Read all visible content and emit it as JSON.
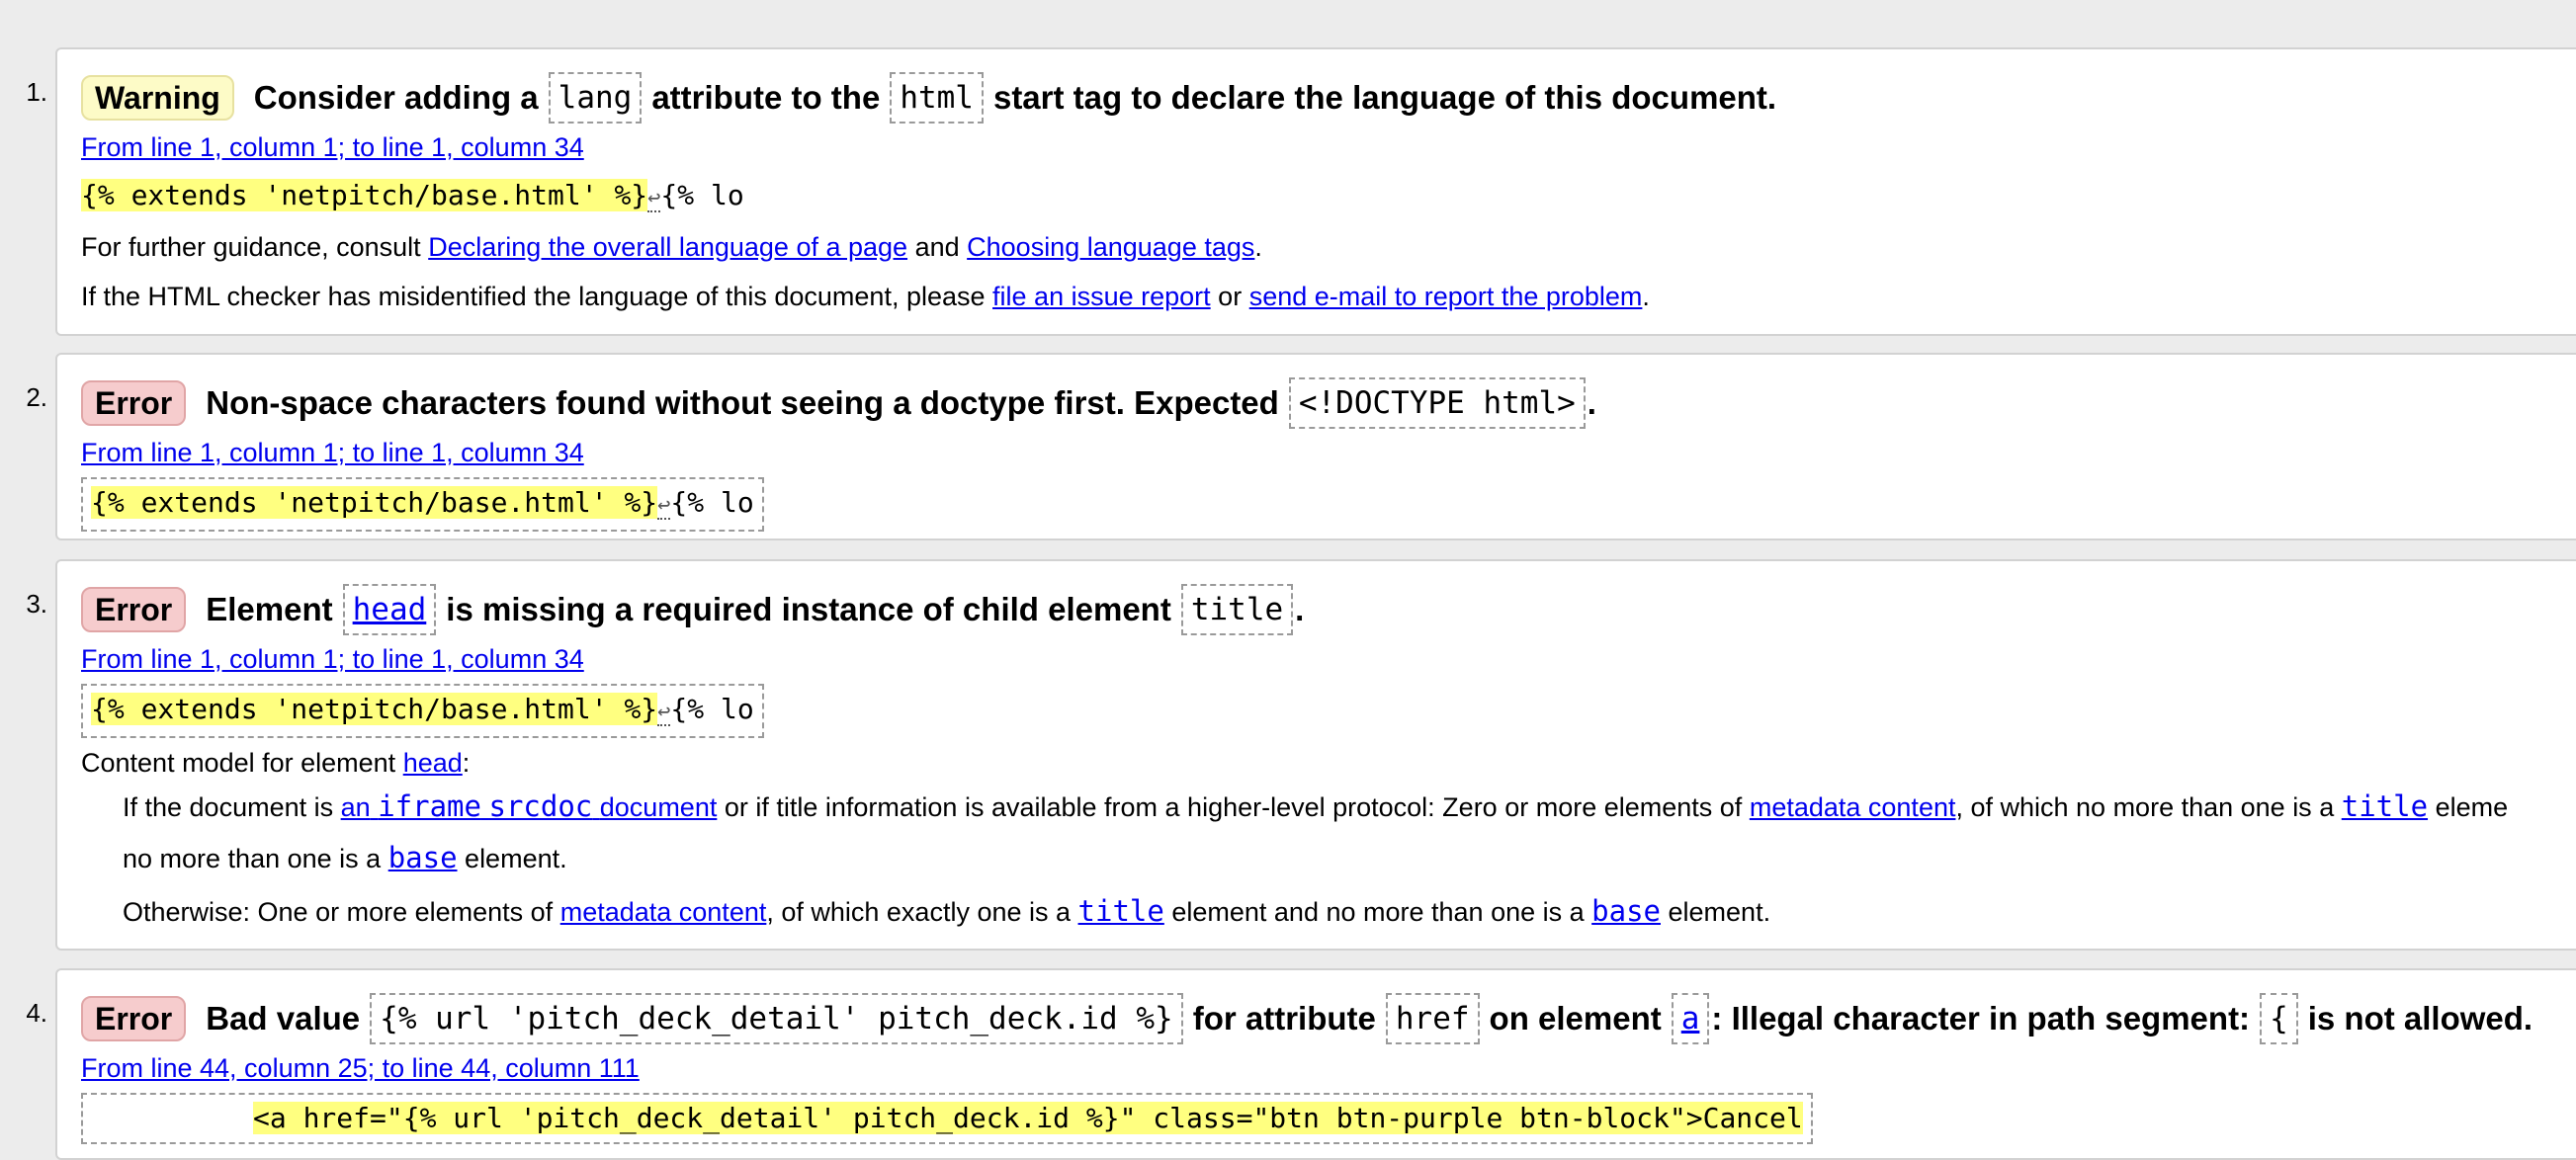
{
  "messages": [
    {
      "number": "1.",
      "type": "Warning",
      "msg": {
        "part1": "Consider adding a",
        "code1": "lang",
        "part2": "attribute to the",
        "code2": "html",
        "part3": "start tag to declare the language of this document."
      },
      "location": "From line 1, column 1; to line 1, column 34",
      "extract": {
        "highlight": "{% extends 'netpitch/base.html' %}",
        "lf": "↩",
        "rest": "{% lo"
      },
      "guidance": {
        "prefix": "For further guidance, consult",
        "link1": "Declaring the overall language of a page",
        "mid": "and",
        "link2": "Choosing language tags",
        "suffix": "."
      },
      "misidentified": {
        "prefix": "If the HTML checker has misidentified the language of this document, please",
        "link1": "file an issue report",
        "mid": "or",
        "link2": "send e-mail to report the problem",
        "suffix": "."
      }
    },
    {
      "number": "2.",
      "type": "Error",
      "msg": {
        "part1": "Non-space characters found without seeing a doctype first. Expected",
        "code1": "<!DOCTYPE html>",
        "part2": "."
      },
      "location": "From line 1, column 1; to line 1, column 34",
      "extract": {
        "highlight": "{% extends 'netpitch/base.html' %}",
        "lf": "↩",
        "rest": "{% lo"
      }
    },
    {
      "number": "3.",
      "type": "Error",
      "msg": {
        "part1": "Element",
        "code1": "head",
        "part2": "is missing a required instance of child element",
        "code2": "title",
        "part3": "."
      },
      "location": "From line 1, column 1; to line 1, column 34",
      "extract": {
        "highlight": "{% extends 'netpitch/base.html' %}",
        "lf": "↩",
        "rest": "{% lo"
      },
      "content_model": {
        "label": "Content model for element",
        "element": "head",
        "colon": ":",
        "para1": {
          "t1": "If the document is",
          "l1a": "an",
          "l1b": "iframe",
          "l1c": "srcdoc",
          "l1d": "document",
          "t2": "or if title information is available from a higher-level protocol: Zero or more elements of",
          "l2": "metadata content",
          "t3": ", of which no more than one is a",
          "l3": "title",
          "t4": "eleme",
          "t5": "no more than one is a",
          "l4": "base",
          "t6": "element."
        },
        "para2": {
          "t1": "Otherwise: One or more elements of",
          "l1": "metadata content",
          "t2": ", of which exactly one is a",
          "l2": "title",
          "t3": "element and no more than one is a",
          "l3": "base",
          "t4": "element."
        }
      }
    },
    {
      "number": "4.",
      "type": "Error",
      "msg": {
        "part1": "Bad value",
        "code1": "{% url 'pitch_deck_detail' pitch_deck.id %}",
        "part2": "for attribute",
        "code2": "href",
        "part3": "on element",
        "code3": "a",
        "part4": ": Illegal character in path segment:",
        "code4": "{",
        "part5": "is not allowed."
      },
      "location": "From line 44, column 25; to line 44, column 111",
      "extract": {
        "highlight": "<a href=\"{% url 'pitch_deck_detail' pitch_deck.id %}\" class=\"btn btn-purple btn-block\">Cancel"
      }
    }
  ]
}
